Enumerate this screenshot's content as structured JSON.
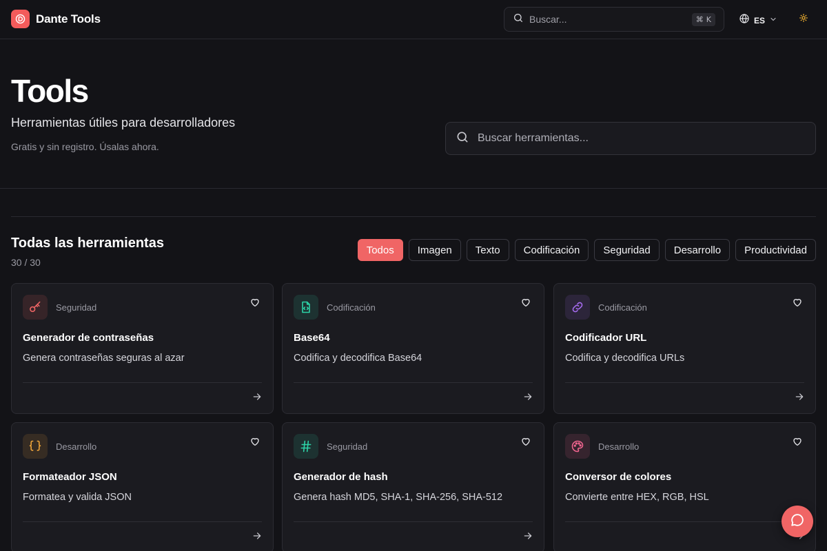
{
  "header": {
    "brand": "Dante Tools",
    "search_placeholder": "Buscar...",
    "shortcut_mod": "⌘",
    "shortcut_key": "K",
    "language": "ES"
  },
  "hero": {
    "title": "Tools",
    "subtitle": "Herramientas útiles para desarrolladores",
    "note": "Gratis y sin registro. Úsalas ahora.",
    "search_placeholder": "Buscar herramientas..."
  },
  "section": {
    "title": "Todas las herramientas",
    "count": "30 / 30"
  },
  "filters": [
    "Todos",
    "Imagen",
    "Texto",
    "Codificación",
    "Seguridad",
    "Desarrollo",
    "Productividad"
  ],
  "active_filter": "Todos",
  "tools": [
    {
      "category": "Seguridad",
      "name": "Generador de contraseñas",
      "description": "Genera contraseñas seguras al azar",
      "icon": "key-icon",
      "color": "#f06565"
    },
    {
      "category": "Codificación",
      "name": "Base64",
      "description": "Codifica y decodifica Base64",
      "icon": "file-code-icon",
      "color": "#2dd4a8"
    },
    {
      "category": "Codificación",
      "name": "Codificador URL",
      "description": "Codifica y decodifica URLs",
      "icon": "link-icon",
      "color": "#a66bf0"
    },
    {
      "category": "Desarrollo",
      "name": "Formateador JSON",
      "description": "Formatea y valida JSON",
      "icon": "braces-icon",
      "color": "#f0a53a"
    },
    {
      "category": "Seguridad",
      "name": "Generador de hash",
      "description": "Genera hash MD5, SHA-1, SHA-256, SHA-512",
      "icon": "hash-icon",
      "color": "#2dd4a8"
    },
    {
      "category": "Desarrollo",
      "name": "Conversor de colores",
      "description": "Convierte entre HEX, RGB, HSL",
      "icon": "palette-icon",
      "color": "#f0648f"
    }
  ],
  "colors": {
    "background": "#131317",
    "card": "#1b1b20",
    "accent": "#f06565",
    "border": "#2c2c33"
  }
}
